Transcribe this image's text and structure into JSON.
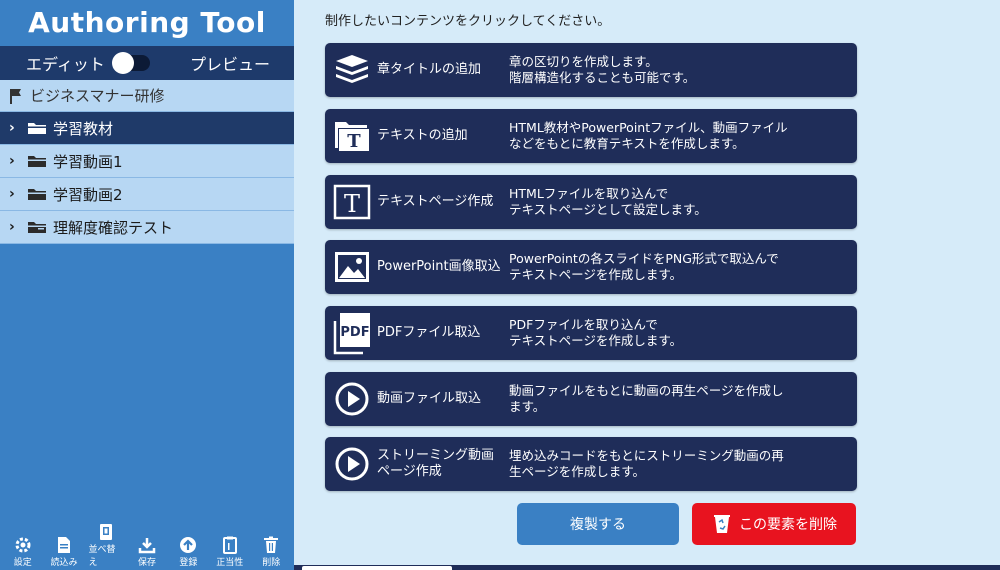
{
  "app": {
    "title": "Authoring Tool"
  },
  "mode": {
    "edit_label": "エディット",
    "preview_label": "プレビュー"
  },
  "tree": {
    "root_label": "ビジネスマナー研修",
    "items": [
      {
        "label": "学習教材",
        "selected": true
      },
      {
        "label": "学習動画1",
        "selected": false
      },
      {
        "label": "学習動画2",
        "selected": false
      },
      {
        "label": "理解度確認テスト",
        "selected": false
      }
    ]
  },
  "tools": [
    {
      "label": "設定",
      "icon": "gear-icon"
    },
    {
      "label": "読込み",
      "icon": "document-icon"
    },
    {
      "label": "並べ替え",
      "icon": "sort-icon"
    },
    {
      "label": "保存",
      "icon": "download-icon"
    },
    {
      "label": "登録",
      "icon": "upload-icon"
    },
    {
      "label": "正当性",
      "icon": "clipboard-icon"
    },
    {
      "label": "削除",
      "icon": "trash-icon"
    }
  ],
  "main": {
    "instruction": "制作したいコンテンツをクリックしてください。",
    "cards": [
      {
        "icon": "stack-icon",
        "title": "章タイトルの追加",
        "desc_1": "章の区切りを作成します。",
        "desc_2": "階層構造化することも可能です。"
      },
      {
        "icon": "folder-text-icon",
        "title": "テキストの追加",
        "desc_1": "HTML教材やPowerPointファイル、動画ファイル",
        "desc_2": "などをもとに教育テキストを作成します。"
      },
      {
        "icon": "text-page-icon",
        "title": "テキストページ作成",
        "desc_1": "HTMLファイルを取り込んで",
        "desc_2": "テキストページとして設定します。"
      },
      {
        "icon": "image-icon",
        "title": "PowerPoint画像取込",
        "desc_1": "PowerPointの各スライドをPNG形式で取込んで",
        "desc_2": "テキストページを作成します。"
      },
      {
        "icon": "pdf-icon",
        "title": "PDFファイル取込",
        "desc_1": "PDFファイルを取り込んで",
        "desc_2": "テキストページを作成します。"
      },
      {
        "icon": "play-icon",
        "title": "動画ファイル取込",
        "desc_1": "動画ファイルをもとに動画の再生ページを作成し",
        "desc_2": "ます。"
      },
      {
        "icon": "play-icon",
        "title_1": "ストリーミング動画",
        "title_2": "ページ作成",
        "desc_1": "埋め込みコードをもとにストリーミング動画の再",
        "desc_2": "生ページを作成します。"
      }
    ],
    "duplicate_label": "複製する",
    "delete_label": "この要素を削除"
  },
  "colors": {
    "sidebar": "#3a80c4",
    "nav_dark": "#1f3a69",
    "card": "#1f2d59",
    "delete": "#e8131f",
    "background": "#d6ebf9"
  }
}
